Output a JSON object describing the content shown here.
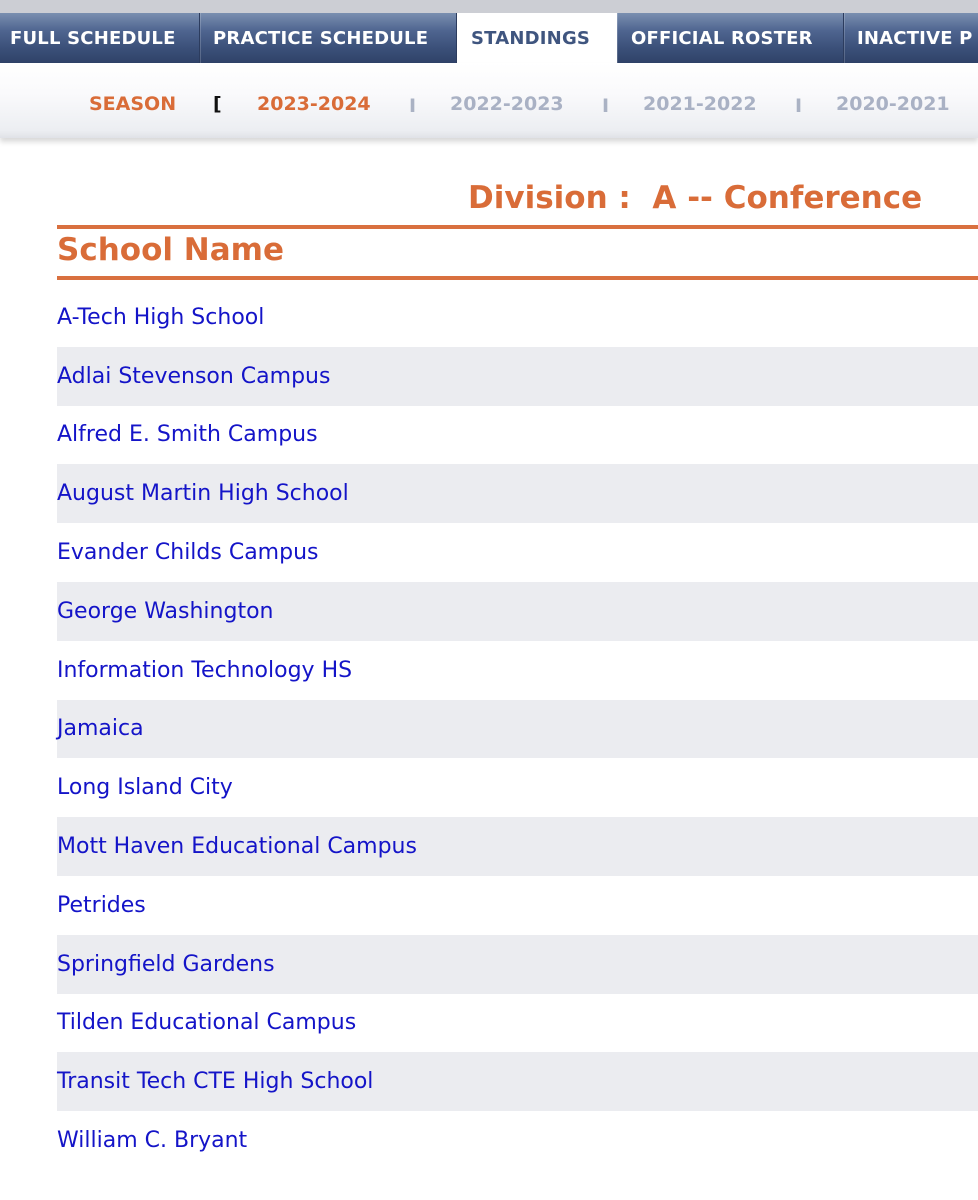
{
  "nav": {
    "tabs": [
      {
        "label": "FULL SCHEDULE",
        "active": false
      },
      {
        "label": "PRACTICE SCHEDULE",
        "active": false
      },
      {
        "label": "STANDINGS",
        "active": true
      },
      {
        "label": "OFFICIAL ROSTER",
        "active": false
      },
      {
        "label": "INACTIVE P",
        "active": false
      }
    ]
  },
  "season": {
    "label": "SEASON",
    "bracket": "[",
    "separator": "I",
    "years": [
      {
        "label": "2023-2024",
        "current": true
      },
      {
        "label": "2022-2023",
        "current": false
      },
      {
        "label": "2021-2022",
        "current": false
      },
      {
        "label": "2020-2021",
        "current": false
      }
    ]
  },
  "standings": {
    "division_title": "Division :  A -- Conference",
    "column_header": "School Name",
    "schools": [
      "A-Tech High School",
      "Adlai Stevenson Campus",
      "Alfred E. Smith Campus",
      "August Martin High School",
      "Evander Childs Campus",
      "George Washington",
      "Information Technology HS",
      "Jamaica",
      "Long Island City",
      "Mott Haven Educational Campus",
      "Petrides",
      "Springfield Gardens",
      "Tilden Educational Campus",
      "Transit Tech CTE High School",
      "William C. Bryant"
    ]
  },
  "colors": {
    "accent_orange": "#d96c38",
    "nav_blue": "#3b5079",
    "link_blue": "#1414c8",
    "inactive_year": "#a9b1c4",
    "row_alt": "#ebecf0"
  }
}
